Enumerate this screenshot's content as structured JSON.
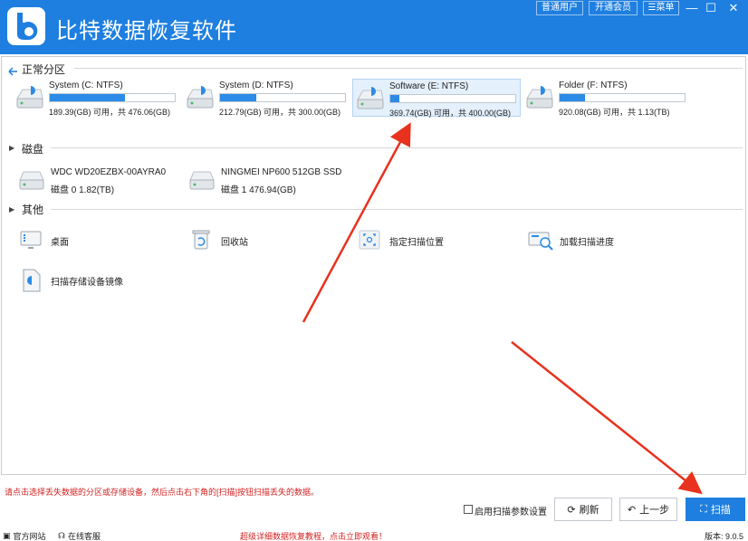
{
  "app": {
    "title": "比特数据恢复软件",
    "buttons": {
      "normal_user": "普通用户",
      "vip": "开通会员",
      "menu": "菜单"
    },
    "window": {
      "minimize": "—",
      "maximize": "☐",
      "close": "✕"
    }
  },
  "sections": {
    "partitions": "正常分区",
    "disks": "磁盘",
    "others": "其他"
  },
  "partitions": [
    {
      "name": "System (C: NTFS)",
      "info": "189.39(GB) 可用，共 476.06(GB)",
      "used_fraction": 0.6,
      "selected": false
    },
    {
      "name": "System (D: NTFS)",
      "info": "212.79(GB) 可用，共 300.00(GB)",
      "used_fraction": 0.29,
      "selected": false
    },
    {
      "name": "Software (E: NTFS)",
      "info": "369.74(GB) 可用，共 400.00(GB)",
      "used_fraction": 0.07,
      "selected": true
    },
    {
      "name": "Folder (F: NTFS)",
      "info": "920.08(GB) 可用，共 1.13(TB)",
      "used_fraction": 0.2,
      "selected": false
    }
  ],
  "disks": [
    {
      "name": "WDC WD20EZBX-00AYRA0",
      "info": "磁盘 0    1.82(TB)"
    },
    {
      "name": "NINGMEI NP600 512GB SSD",
      "info": "磁盘 1    476.94(GB)"
    }
  ],
  "others": [
    {
      "label": "桌面",
      "icon": "desktop-icon"
    },
    {
      "label": "回收站",
      "icon": "recycle-bin-icon"
    },
    {
      "label": "指定扫描位置",
      "icon": "scan-location-icon"
    },
    {
      "label": "加载扫描进度",
      "icon": "load-progress-icon"
    },
    {
      "label": "扫描存储设备镜像",
      "icon": "disk-image-icon"
    }
  ],
  "bottom": {
    "hint": "请点击选择丢失数据的分区或存储设备，然后点击右下角的[扫描]按钮扫描丢失的数据。",
    "checkbox_label": "启用扫描参数设置",
    "refresh": "刷新",
    "back": "上一步",
    "scan": "扫描"
  },
  "footer": {
    "website": "官方网站",
    "support": "在线客服",
    "promo": "超级详细数据恢复教程，点击立即观看！",
    "version": "版本: 9.0.5"
  },
  "colors": {
    "accent": "#1e7fe0",
    "bar": "#2b8be6",
    "warning": "#d42222",
    "annotation": "#e8321e"
  }
}
